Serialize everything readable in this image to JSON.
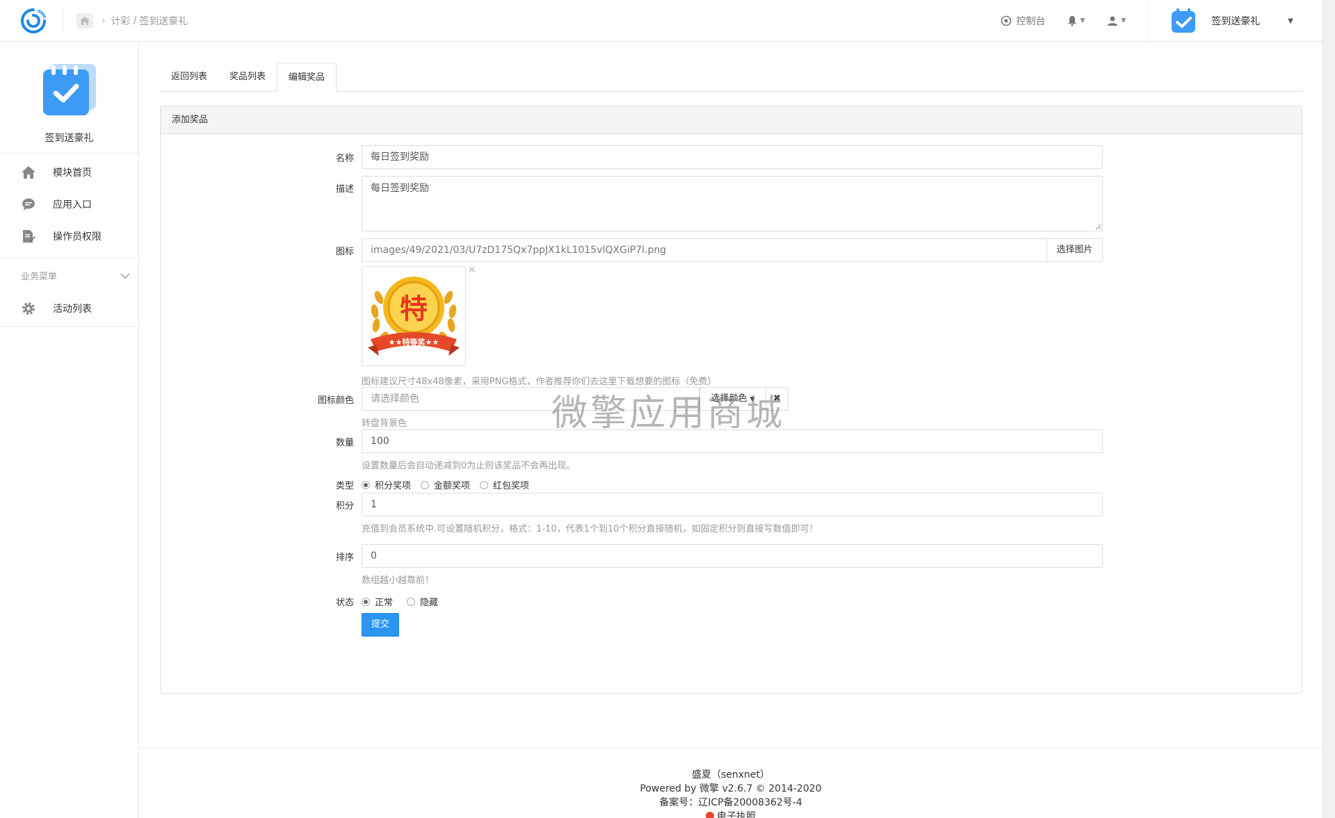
{
  "header": {
    "breadcrumb": [
      "计彩",
      "签到送豪礼"
    ],
    "console_label": "控制台",
    "app_name": "签到送豪礼"
  },
  "sidebar": {
    "app_name": "签到送豪礼",
    "items": [
      {
        "label": "模块首页",
        "icon": "home-icon"
      },
      {
        "label": "应用入口",
        "icon": "comment-icon"
      },
      {
        "label": "操作员权限",
        "icon": "edit-doc-icon"
      }
    ],
    "group_label": "业务菜单",
    "group_items": [
      {
        "label": "活动列表",
        "icon": "gear-icon"
      }
    ]
  },
  "tabs": [
    "返回列表",
    "奖品列表",
    "编辑奖品"
  ],
  "active_tab": "编辑奖品",
  "form": {
    "title": "添加奖品",
    "name_label": "名称",
    "name_value": "每日签到奖励",
    "desc_label": "描述",
    "desc_value": "每日签到奖励",
    "icon_label": "图标",
    "icon_value": "images/49/2021/03/U7zD175Qx7ppJX1kL1015vlQXGiP7l.png",
    "icon_button": "选择图片",
    "icon_image_text": "特",
    "icon_ribbon_text": "★★特等奖★★",
    "icon_help": "图标建议尺寸48x48像素，采用PNG格式，作者推荐你们去这里下载想要的图标（免费）",
    "color_label": "图标颜色",
    "color_placeholder": "请选择颜色",
    "color_button": "选择颜色",
    "color_help": "转盘背景色",
    "qty_label": "数量",
    "qty_value": "100",
    "qty_help": "设置数量后会自动递减到0为止则该奖品不会再出现。",
    "type_label": "类型",
    "type_options": [
      "积分奖项",
      "金额奖项",
      "红包奖项"
    ],
    "type_selected": "积分奖项",
    "points_label": "积分",
    "points_value": "1",
    "points_help": "充值到会员系统中.可设置随机积分，格式：1-10，代表1个到10个积分直接随机，如固定积分则直接写数值即可！",
    "sort_label": "排序",
    "sort_value": "0",
    "sort_help": "数组越小越靠前！",
    "status_label": "状态",
    "status_options": [
      "正常",
      "隐藏"
    ],
    "status_selected": "正常",
    "submit_label": "提交"
  },
  "watermark": "微擎应用商城",
  "footer": {
    "line1": "盛夏（senxnet）",
    "line2": "Powered by 微擎 v2.6.7 © 2014-2020",
    "line3": "备案号：辽ICP备20008362号-4",
    "line4": "电子执照"
  },
  "colors": {
    "primary": "#2b95f2",
    "logo_blue": "#1e88e5",
    "app_icon_blue": "#3d9af5"
  }
}
